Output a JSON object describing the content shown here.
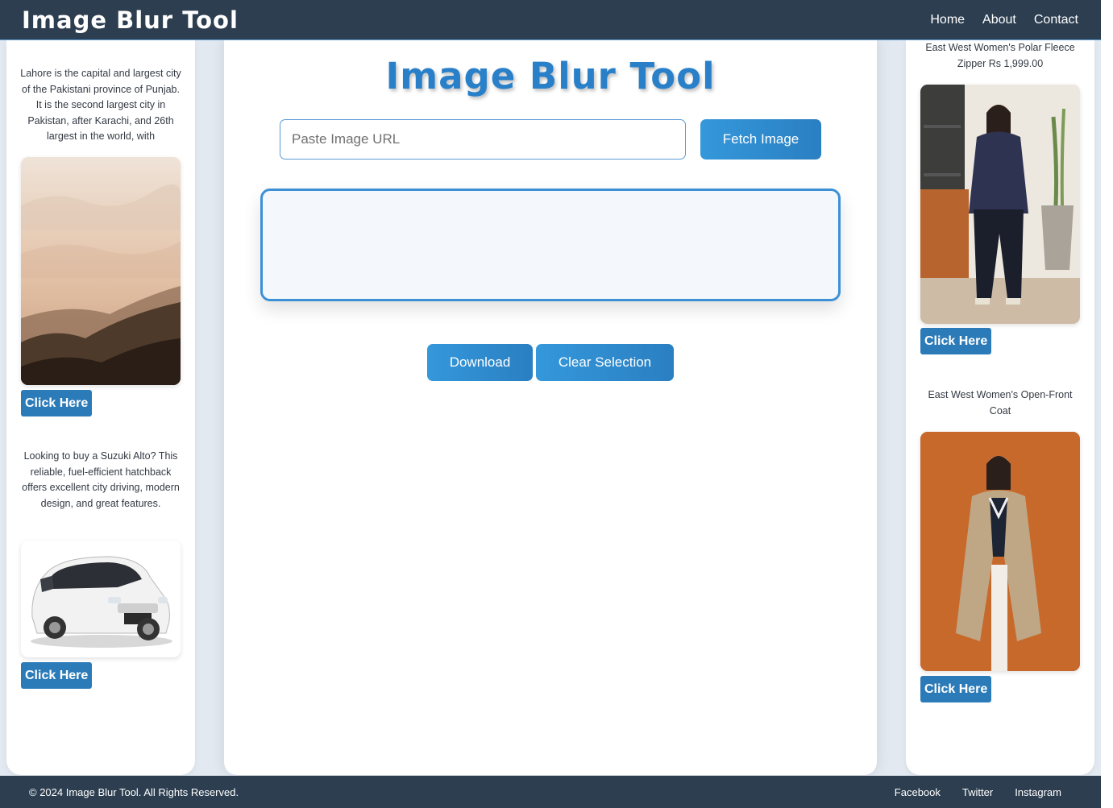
{
  "header": {
    "brand": "Image Blur Tool",
    "nav": [
      "Home",
      "About",
      "Contact"
    ]
  },
  "left_sidebar": {
    "ads": [
      {
        "text": "Lahore is the capital and largest city of the Pakistani province of Punjab. It is the second largest city in Pakistan, after Karachi, and 26th largest in the world, with",
        "image": "misty-mountain-landscape",
        "button": "Click Here"
      },
      {
        "text": "Looking to buy a Suzuki Alto? This reliable, fuel-efficient hatchback offers excellent city driving, modern design, and great features.",
        "image": "white-suzuki-alto-car",
        "button": "Click Here"
      }
    ]
  },
  "right_sidebar": {
    "ads": [
      {
        "text": "East West Women's Polar Fleece Zipper Rs 1,999.00",
        "image": "woman-in-navy-fleece-jacket",
        "button": "Click Here"
      },
      {
        "text": "East West Women's Open-Front Coat",
        "image": "woman-in-beige-trench-coat",
        "button": "Click Here"
      }
    ]
  },
  "main": {
    "title": "Image Blur Tool",
    "url_placeholder": "Paste Image URL",
    "url_value": "",
    "fetch_button": "Fetch Image",
    "download_button": "Download",
    "clear_button": "Clear Selection"
  },
  "footer": {
    "copyright": "© 2024 Image Blur Tool. All Rights Reserved.",
    "links": [
      "Facebook",
      "Twitter",
      "Instagram"
    ]
  },
  "colors": {
    "header_bg": "#2c3e50",
    "accent": "#2980c9",
    "button": "#2b7bb9"
  }
}
